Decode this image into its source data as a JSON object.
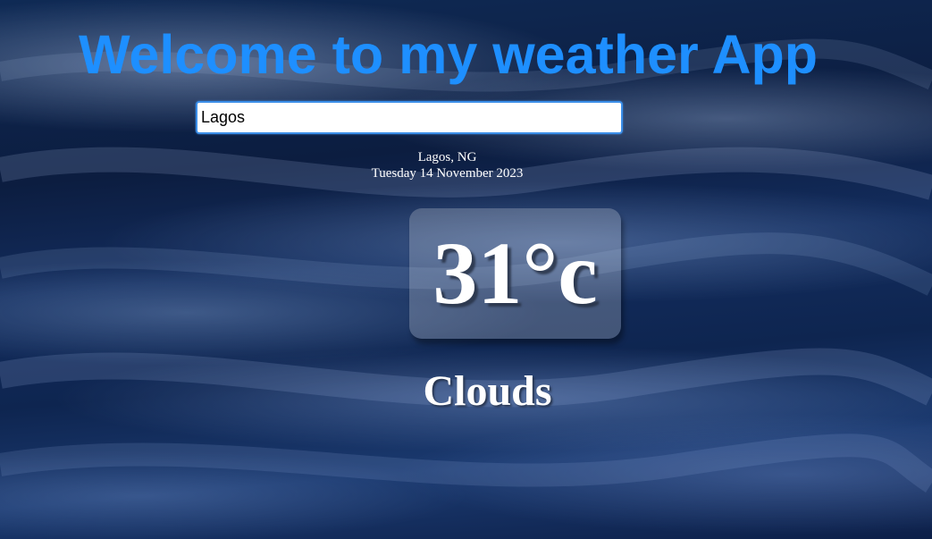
{
  "app": {
    "title": "Welcome to my weather App"
  },
  "search": {
    "value": "Lagos"
  },
  "location": {
    "city_country": "Lagos, NG",
    "date": "Tuesday 14 November 2023"
  },
  "weather": {
    "temperature": "31°c",
    "condition": "Clouds"
  },
  "colors": {
    "title": "#1e8fff",
    "background": "#0f2a55",
    "text": "#ffffff"
  }
}
